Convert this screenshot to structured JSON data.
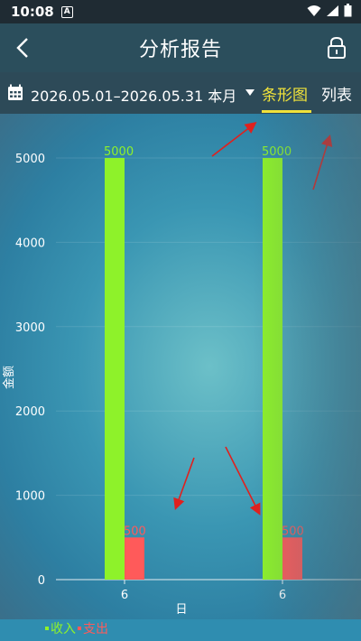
{
  "status_bar": {
    "time": "10:08",
    "app_badge": "A"
  },
  "app_bar": {
    "title": "分析报告"
  },
  "filter": {
    "date_range": "2026.05.01–2026.05.31 本月",
    "tabs": [
      {
        "label": "条形图",
        "active": true
      },
      {
        "label": "列表",
        "active": false
      }
    ]
  },
  "colors": {
    "income": "#8ef22a",
    "expense": "#ff5a5a",
    "active_tab": "#f0e23a"
  },
  "chart_data": {
    "type": "bar",
    "categories": [
      "6",
      "6"
    ],
    "series": [
      {
        "name": "收入",
        "values": [
          5000,
          5000
        ]
      },
      {
        "name": "支出",
        "values": [
          500,
          500
        ]
      }
    ],
    "xlabel": "日",
    "ylabel": "金额",
    "yticks": [
      0,
      1000,
      2000,
      3000,
      4000,
      5000
    ],
    "ylim": [
      0,
      5300
    ],
    "legend_position": "bottom-left",
    "grid": true
  },
  "legend": {
    "income": "收入",
    "expense": "支出"
  }
}
